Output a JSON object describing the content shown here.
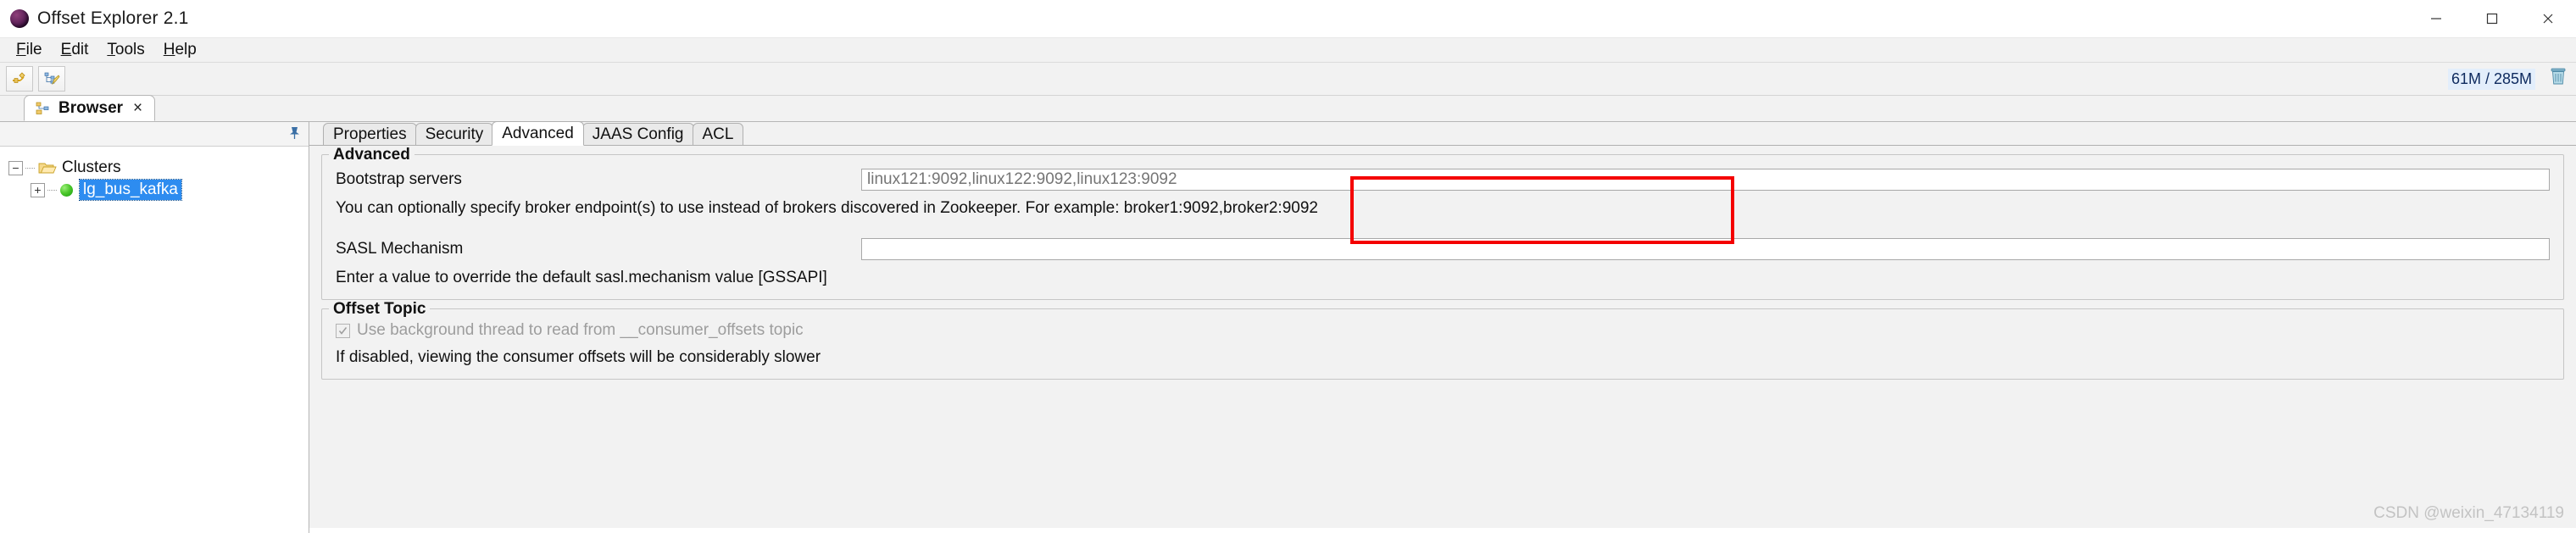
{
  "window": {
    "title": "Offset Explorer  2.1",
    "logo_icon": "offset-explorer-logo",
    "minimize_icon": "minimize-icon",
    "maximize_icon": "maximize-icon",
    "close_icon": "close-icon"
  },
  "menubar": {
    "items": [
      {
        "mnemonic": "F",
        "rest": "ile"
      },
      {
        "mnemonic": "E",
        "rest": "dit"
      },
      {
        "mnemonic": "T",
        "rest": "ools"
      },
      {
        "mnemonic": "H",
        "rest": "elp"
      }
    ]
  },
  "toolbar": {
    "buttons": [
      {
        "name": "add-connection-button",
        "icon": "plug-connect-icon"
      },
      {
        "name": "edit-connection-button",
        "icon": "tree-edit-pencil-icon"
      }
    ],
    "memory": "61M / 285M",
    "gc_icon": "trash-icon"
  },
  "tabstrip": {
    "browser_tab": {
      "label": "Browser",
      "icon": "tree-browser-icon",
      "close": "×"
    }
  },
  "tree": {
    "pin_icon": "pin-icon",
    "root": {
      "label": "Clusters",
      "expander": "−",
      "icon": "folder-open-icon"
    },
    "child": {
      "label": "lg_bus_kafka",
      "expander": "+",
      "icon": "cluster-green-dot",
      "selected": true
    }
  },
  "content": {
    "tabs": [
      {
        "label": "Properties",
        "active": false
      },
      {
        "label": "Security",
        "active": false
      },
      {
        "label": "Advanced",
        "active": true
      },
      {
        "label": "JAAS Config",
        "active": false
      },
      {
        "label": "ACL",
        "active": false
      }
    ],
    "advanced_group": {
      "title": "Advanced",
      "bootstrap": {
        "label": "Bootstrap servers",
        "value": "",
        "placeholder": "linux121:9092,linux122:9092,linux123:9092",
        "hint": "You can optionally specify broker endpoint(s) to use instead of brokers discovered in Zookeeper. For example: broker1:9092,broker2:9092"
      },
      "sasl": {
        "label": "SASL Mechanism",
        "value": "",
        "placeholder": "",
        "hint": "Enter a value to override the default sasl.mechanism value [GSSAPI]"
      }
    },
    "offset_topic_group": {
      "title": "Offset Topic",
      "checkbox": {
        "label": "Use background thread to read from __consumer_offsets topic",
        "checked": true,
        "disabled": true
      },
      "hint": "If disabled, viewing the consumer offsets will be considerably slower"
    }
  },
  "annotation": {
    "highlight_color": "#f40000"
  },
  "watermark": "CSDN @weixin_47134119"
}
